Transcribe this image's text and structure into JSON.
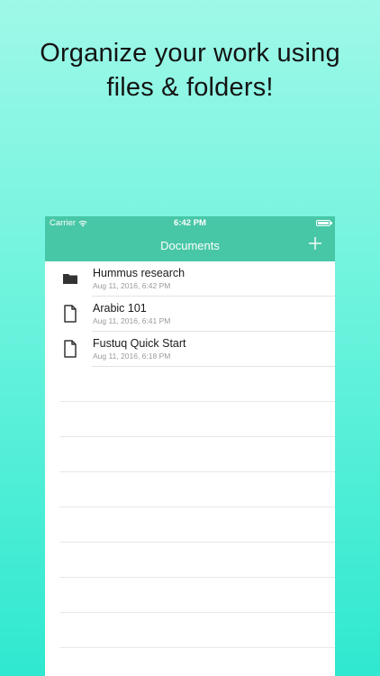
{
  "promo": {
    "line1": "Organize your work using",
    "line2": "files & folders!"
  },
  "status_bar": {
    "carrier": "Carrier",
    "time": "6:42 PM",
    "battery_level": 1.0
  },
  "nav": {
    "title": "Documents",
    "add_icon": "plus-icon"
  },
  "items": [
    {
      "name": "Hummus research",
      "date": "Aug 11, 2016, 6:42 PM",
      "icon": "folder-icon"
    },
    {
      "name": "Arabic 101",
      "date": "Aug 11, 2016, 6:41 PM",
      "icon": "document-icon"
    },
    {
      "name": "Fustuq Quick Start",
      "date": "Aug 11, 2016, 6:18 PM",
      "icon": "document-icon"
    }
  ],
  "colors": {
    "nav_background": "#48c7a6",
    "background_top": "#9ff8e8",
    "background_bottom": "#2fe8cf"
  }
}
